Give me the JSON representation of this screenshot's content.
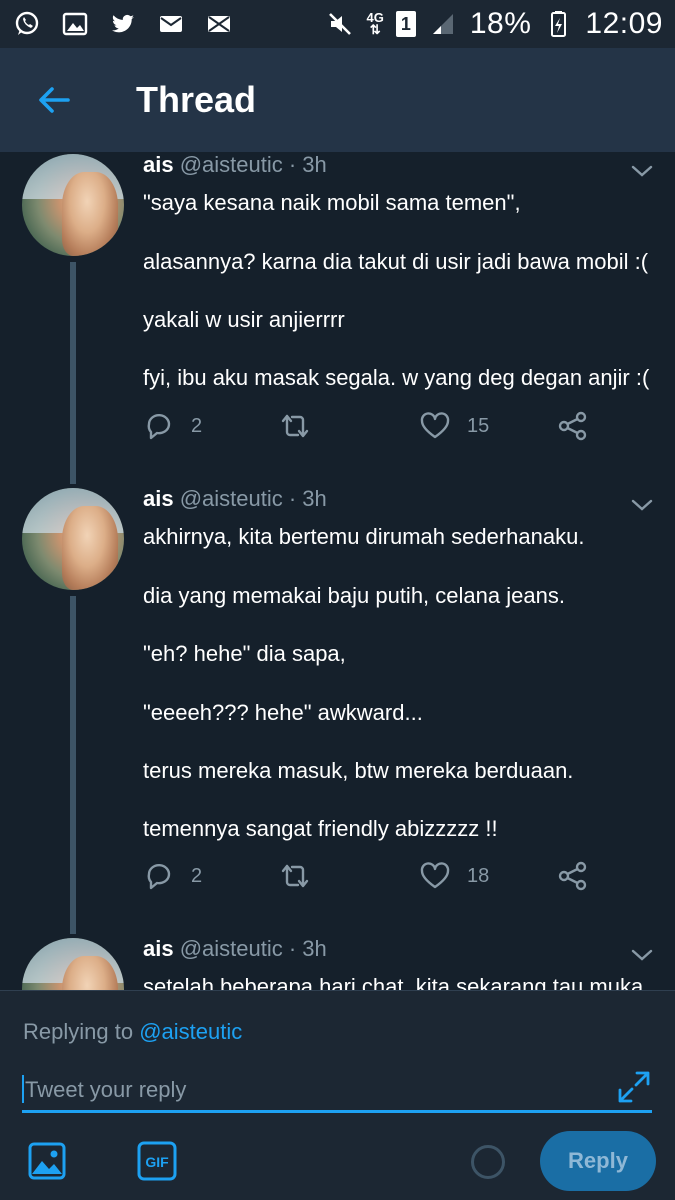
{
  "status_bar": {
    "network": "4G",
    "sim": "1",
    "battery": "18%",
    "time": "12:09"
  },
  "header": {
    "title": "Thread"
  },
  "tweets": [
    {
      "name": "ais",
      "handle": "@aisteutic · 3h",
      "lines": [
        "\"saya kesana naik mobil sama temen\",",
        "alasannya? karna dia takut di usir jadi bawa mobil :(",
        "yakali w usir anjierrrr",
        "fyi, ibu aku masak segala. w yang deg degan anjir :("
      ],
      "replies": "2",
      "likes": "15"
    },
    {
      "name": "ais",
      "handle": "@aisteutic · 3h",
      "lines": [
        "akhirnya, kita bertemu dirumah sederhanaku.",
        "dia yang memakai baju putih, celana jeans.",
        "\"eh? hehe\" dia sapa,",
        "\"eeeeh??? hehe\" awkward...",
        "terus mereka masuk, btw mereka berduaan.",
        "temennya sangat friendly abizzzzz !!"
      ],
      "replies": "2",
      "likes": "18"
    },
    {
      "name": "ais",
      "handle": "@aisteutic · 3h",
      "lines": [
        "setelah beberapa hari chat, kita sekarang tau muka"
      ]
    }
  ],
  "composer": {
    "replying_prefix": "Replying to ",
    "replying_to": "@aisteutic",
    "placeholder": "Tweet your reply",
    "gif_label": "GIF",
    "reply_label": "Reply"
  },
  "colors": {
    "background": "#15202b",
    "header": "#243447",
    "accent": "#1da1f2",
    "muted": "#8899a6"
  }
}
